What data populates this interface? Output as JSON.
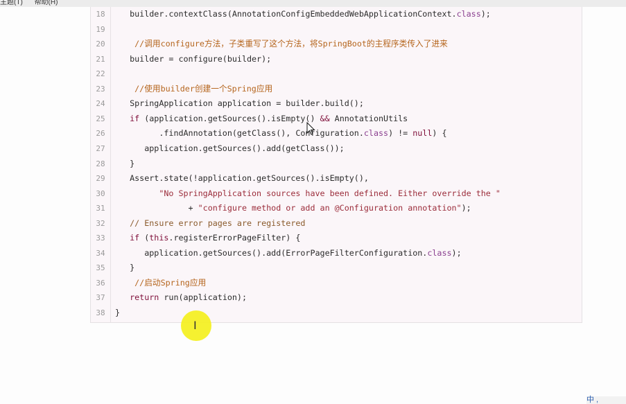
{
  "menubar": {
    "items": [
      "主题(T)",
      "帮助(H)"
    ]
  },
  "code": {
    "lines": [
      {
        "n": "18",
        "segs": [
          [
            "",
            "   builder.contextClass(AnnotationConfigEmbeddedWebApplicationContext."
          ],
          [
            "cls",
            "class"
          ],
          [
            "",
            ");"
          ]
        ]
      },
      {
        "n": "19",
        "segs": []
      },
      {
        "n": "20",
        "segs": [
          [
            "cm",
            "    //调用configure方法，子类重写了这个方法，将SpringBoot的主程序类传入了进来"
          ]
        ]
      },
      {
        "n": "21",
        "segs": [
          [
            "",
            "   builder = configure(builder);"
          ]
        ]
      },
      {
        "n": "22",
        "segs": []
      },
      {
        "n": "23",
        "segs": [
          [
            "cm",
            "    //使用builder创建一个Spring应用"
          ]
        ]
      },
      {
        "n": "24",
        "segs": [
          [
            "",
            "   SpringApplication application = builder.build();"
          ]
        ]
      },
      {
        "n": "25",
        "segs": [
          [
            "kw",
            "   if"
          ],
          [
            "",
            " (application.getSources().isEmpty() "
          ],
          [
            "kw",
            "&&"
          ],
          [
            "",
            " AnnotationUtils"
          ]
        ]
      },
      {
        "n": "26",
        "segs": [
          [
            "",
            "         .findAnnotation(getClass(), Configuration."
          ],
          [
            "cls",
            "class"
          ],
          [
            "",
            ") != "
          ],
          [
            "kw",
            "null"
          ],
          [
            "",
            ") {"
          ]
        ]
      },
      {
        "n": "27",
        "segs": [
          [
            "",
            "      application.getSources().add(getClass());"
          ]
        ]
      },
      {
        "n": "28",
        "segs": [
          [
            "",
            "   }"
          ]
        ]
      },
      {
        "n": "29",
        "segs": [
          [
            "",
            "   Assert.state(!application.getSources().isEmpty(),"
          ]
        ]
      },
      {
        "n": "30",
        "segs": [
          [
            "str",
            "         \"No SpringApplication sources have been defined. Either override the \""
          ]
        ]
      },
      {
        "n": "31",
        "segs": [
          [
            "",
            "               + "
          ],
          [
            "str",
            "\"configure method or add an @Configuration annotation\""
          ],
          [
            "",
            ");"
          ]
        ]
      },
      {
        "n": "32",
        "segs": [
          [
            "cm2",
            "   // Ensure error pages are registered"
          ]
        ]
      },
      {
        "n": "33",
        "segs": [
          [
            "kw",
            "   if"
          ],
          [
            "",
            " ("
          ],
          [
            "kw",
            "this"
          ],
          [
            "",
            ".registerErrorPageFilter) {"
          ]
        ]
      },
      {
        "n": "34",
        "segs": [
          [
            "",
            "      application.getSources().add(ErrorPageFilterConfiguration."
          ],
          [
            "cls",
            "class"
          ],
          [
            "",
            ");"
          ]
        ]
      },
      {
        "n": "35",
        "segs": [
          [
            "",
            "   }"
          ]
        ]
      },
      {
        "n": "36",
        "segs": [
          [
            "cm",
            "    //启动Spring应用"
          ]
        ]
      },
      {
        "n": "37",
        "segs": [
          [
            "kw",
            "   return"
          ],
          [
            "",
            " run(application);"
          ]
        ]
      },
      {
        "n": "38",
        "segs": [
          [
            "",
            "}"
          ]
        ]
      }
    ]
  },
  "tray": {
    "text": "中 ,"
  },
  "colors": {
    "highlight": "#f4ef1a",
    "keyword": "#7f0f3a",
    "comment": "#b5651d",
    "string": "#9b2c3a"
  }
}
